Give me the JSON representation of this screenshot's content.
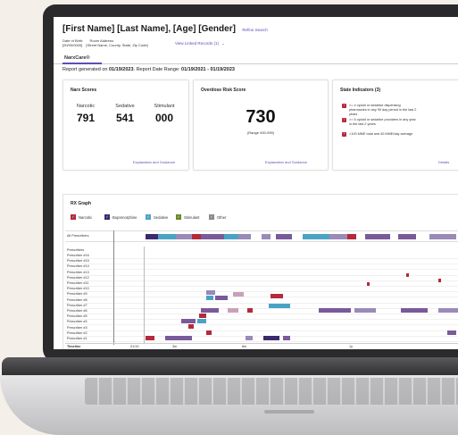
{
  "header": {
    "name": "[First Name] [Last Name], [Age] [Gender]",
    "refine": "Refine Search",
    "dob_label": "Date of Birth:",
    "dob_value": "[00/00/0000]",
    "address_label": "Room Address:",
    "address_value": "[Street Name, County, State, Zip Code]",
    "linked": "View Linked Records (1)"
  },
  "tab": {
    "label": "NarxCare®"
  },
  "report": {
    "prefix": "Report generated on",
    "date": "01/19/2023",
    "middle": ". Report Date Range:",
    "range": "01/19/2021 - 01/19/2023"
  },
  "narx": {
    "title": "Narx Scores",
    "scores": [
      {
        "label": "Narcotic",
        "value": "791"
      },
      {
        "label": "Sedative",
        "value": "541"
      },
      {
        "label": "Stimulant",
        "value": "000"
      }
    ],
    "link": "Explanation and Guidance"
  },
  "risk": {
    "title": "Overdose Risk Score",
    "value": "730",
    "range": "(Range 000-999)",
    "link": "Explanation and Guidance"
  },
  "state": {
    "title": "State Indicators (3)",
    "items": [
      ">= 4 opioid or sedative dispensing pharmacies in any 90 day period in the last 2 years",
      ">= 5 opioid or sedative providers in any year in the last 2 years",
      ">100 MME total and 40 MME/day average"
    ],
    "details": "Details"
  },
  "graph": {
    "title": "RX Graph",
    "legend": [
      {
        "label": "Narcotic",
        "color": "#b32a3b"
      },
      {
        "label": "Buprenorphine",
        "color": "#3b2a6e"
      },
      {
        "label": "Sedative",
        "color": "#4aa3c4"
      },
      {
        "label": "Stimulant",
        "color": "#6a8a2a"
      },
      {
        "label": "Other",
        "color": "#8a8a8a"
      }
    ],
    "all_prescribers": "All Prescribers",
    "prescribers_header": "Prescribers",
    "prescribers": [
      "Prescriber #16",
      "Prescriber #15",
      "Prescriber #14",
      "Prescriber #13",
      "Prescriber #12",
      "Prescriber #11",
      "Prescriber #10",
      "Prescriber #9",
      "Prescriber #8",
      "Prescriber #7",
      "Prescriber #6",
      "Prescriber #5",
      "Prescriber #4",
      "Prescriber #3",
      "Prescriber #2",
      "Prescriber #1"
    ],
    "timeline_label": "Timeline",
    "ticks": [
      "01/19",
      "3m",
      "6m",
      "1y"
    ]
  }
}
